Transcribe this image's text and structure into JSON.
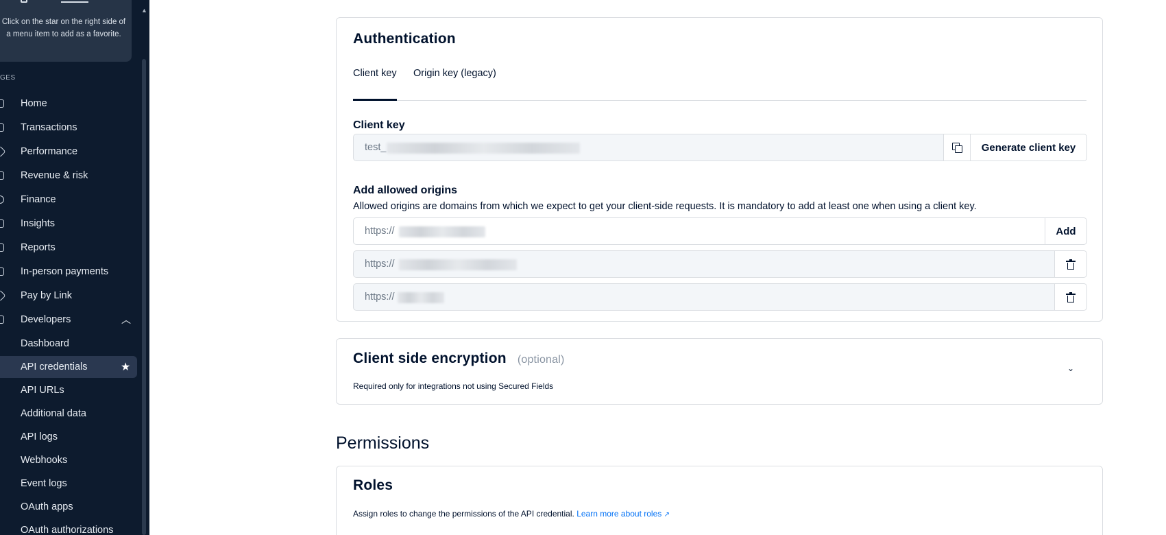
{
  "sidebar": {
    "favorite_tip": "Click on the star on the right side of a menu item to add as a favorite.",
    "section_label": "GES",
    "items": [
      {
        "label": "Home",
        "icon": "home-icon"
      },
      {
        "label": "Transactions",
        "icon": "transactions-icon"
      },
      {
        "label": "Performance",
        "icon": "performance-icon"
      },
      {
        "label": "Revenue & risk",
        "icon": "revenue-icon"
      },
      {
        "label": "Finance",
        "icon": "finance-icon"
      },
      {
        "label": "Insights",
        "icon": "insights-icon"
      },
      {
        "label": "Reports",
        "icon": "reports-icon"
      },
      {
        "label": "In-person payments",
        "icon": "in-person-icon"
      },
      {
        "label": "Pay by Link",
        "icon": "pay-by-link-icon"
      },
      {
        "label": "Developers",
        "icon": "developers-icon"
      }
    ],
    "developer_sub_items": [
      {
        "label": "Dashboard"
      },
      {
        "label": "API credentials",
        "active": true
      },
      {
        "label": "API URLs"
      },
      {
        "label": "Additional data"
      },
      {
        "label": "API logs"
      },
      {
        "label": "Webhooks"
      },
      {
        "label": "Event logs"
      },
      {
        "label": "OAuth apps"
      },
      {
        "label": "OAuth authorizations"
      }
    ]
  },
  "authentication": {
    "title": "Authentication",
    "tabs": [
      {
        "label": "Client key",
        "active": true
      },
      {
        "label": "Origin key (legacy)",
        "active": false
      }
    ],
    "client_key_label": "Client key",
    "client_key_value": "test_",
    "generate_button": "Generate client key",
    "origins_label": "Add allowed origins",
    "origins_helper": "Allowed origins are domains from which we expect to get your client-side requests. It is mandatory to add at least one when using a client key.",
    "new_origin_value": "https://",
    "add_button": "Add",
    "origins": [
      "https://",
      "https://"
    ]
  },
  "cse": {
    "title": "Client side encryption",
    "optional": "(optional)",
    "description": "Required only for integrations not using Secured Fields"
  },
  "permissions": {
    "heading": "Permissions",
    "roles_title": "Roles",
    "roles_text": "Assign roles to change the permissions of the API credential.",
    "roles_link": "Learn more about roles"
  },
  "colors": {
    "sidebar_bg": "#0d1b2e",
    "text_primary": "#00112c",
    "link": "#0070f5"
  }
}
